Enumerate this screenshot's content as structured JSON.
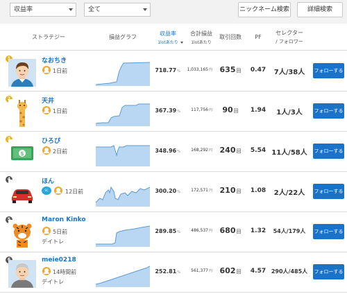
{
  "filters": {
    "sort_select": "収益率",
    "period_select": "全て",
    "nickname_search_button": "ニックネーム検索",
    "detail_search_button": "詳細検索"
  },
  "columns": {
    "strategy": "ストラテジー",
    "graph": "損益グラフ",
    "return_rate": "収益率",
    "return_rate_sub": "1lotあたり",
    "total_pnl": "合計損益",
    "total_pnl_sub": "1lotあたり",
    "trades": "取引回数",
    "pf": "PF",
    "selector": "セレクター",
    "selector_sub": "/ フォロワー"
  },
  "follow_label": "フォローする",
  "rows": [
    {
      "rank": "1",
      "name": "なおちき",
      "ago": "1日前",
      "tag": "",
      "return": "718.77",
      "return_unit": "%",
      "pnl": "1,033,165",
      "pnl_unit": "円",
      "trades": "635",
      "trades_unit": "回",
      "pf": "0.47",
      "selector": "7人/38人"
    },
    {
      "rank": "2",
      "name": "天井",
      "ago": "1日前",
      "tag": "",
      "return": "367.39",
      "return_unit": "%",
      "pnl": "117,756",
      "pnl_unit": "円",
      "trades": "90",
      "trades_unit": "回",
      "pf": "1.94",
      "selector": "1人/3人"
    },
    {
      "rank": "3",
      "name": "ひろぴ",
      "ago": "2日前",
      "tag": "",
      "return": "348.96",
      "return_unit": "%",
      "pnl": "168,292",
      "pnl_unit": "円",
      "trades": "240",
      "trades_unit": "回",
      "pf": "5.54",
      "selector": "11人/58人"
    },
    {
      "rank": "4",
      "name": "ほん",
      "ago": "12日前",
      "badge": "Select\nColor",
      "tag": "",
      "return": "300.20",
      "return_unit": "%",
      "pnl": "172,571",
      "pnl_unit": "円",
      "trades": "210",
      "trades_unit": "回",
      "pf": "1.08",
      "selector": "2人/22人"
    },
    {
      "rank": "5",
      "name": "Maron Kinko",
      "ago": "5日前",
      "tag": "デイトレ",
      "return": "289.85",
      "return_unit": "%",
      "pnl": "486,537",
      "pnl_unit": "円",
      "trades": "680",
      "trades_unit": "回",
      "pf": "1.32",
      "selector": "54人/179人"
    },
    {
      "rank": "6",
      "name": "meie0218",
      "ago": "14時間前",
      "tag": "デイトレ",
      "return": "252.81",
      "return_unit": "%",
      "pnl": "561,377",
      "pnl_unit": "円",
      "trades": "602",
      "trades_unit": "回",
      "pf": "4.57",
      "selector": "290人/485人"
    }
  ],
  "colors": {
    "accent": "#1a73c9",
    "chart_fill": "#b9d7f2",
    "chart_line": "#5b9bd5",
    "rank_gold": "#e6b422",
    "rank_silver": "#a0a0a0",
    "rank_bronze": "#c07a3a"
  }
}
